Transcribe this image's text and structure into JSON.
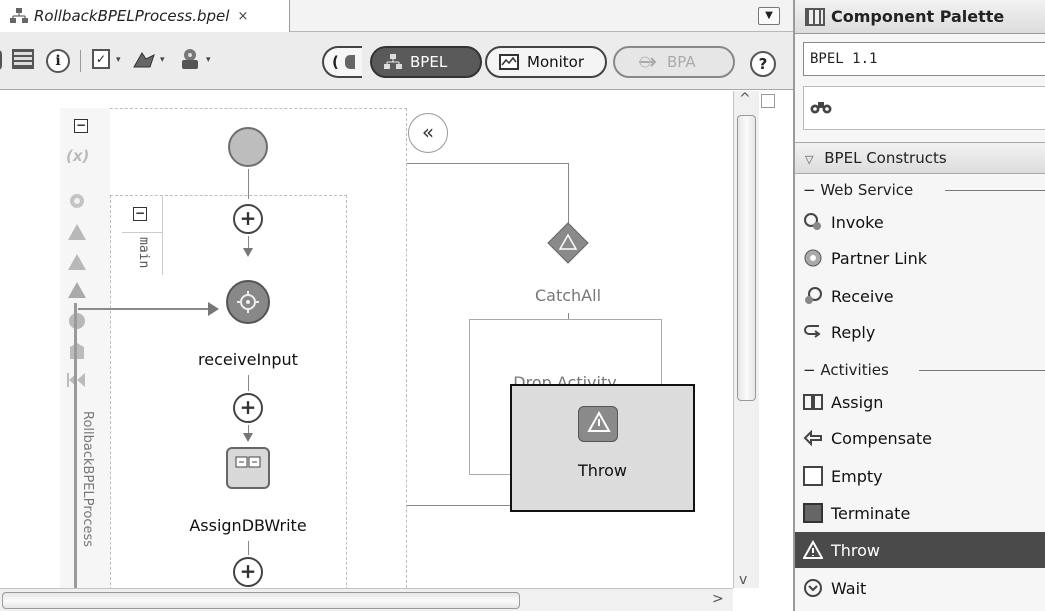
{
  "editor": {
    "tab": {
      "title": "RollbackBPELProcess.bpel",
      "close": "×"
    },
    "tab_menu": "▼",
    "toolbar": {
      "info": "i",
      "dropdown_arrow": "▾",
      "partial_button": "(",
      "bpel_label": "BPEL",
      "monitor_label": "Monitor",
      "bpa_label": "BPA",
      "help": "?"
    },
    "collapse_arrow": "«",
    "diagram": {
      "main_label": "main",
      "process_label": "RollbackBPELProcess",
      "nodes": {
        "receive": "receiveInput",
        "assign": "AssignDBWrite",
        "catchall": "CatchAll",
        "drop_hint": "Drop Activity Here",
        "throw": "Throw"
      },
      "gutter_variable": "(x)",
      "collapse": "⊟"
    },
    "scroll": {
      "up": "^",
      "down": "v",
      "right": ">"
    }
  },
  "palette": {
    "title": "Component Palette",
    "selected_library": "BPEL 1.1",
    "search_icon": "binoculars",
    "section": "BPEL Constructs",
    "section_toggle": "▽",
    "groups": [
      {
        "label": "Web Service",
        "items": [
          "Invoke",
          "Partner Link",
          "Receive",
          "Reply"
        ]
      },
      {
        "label": "Activities",
        "items": [
          "Assign",
          "Compensate",
          "Empty",
          "Terminate",
          "Throw",
          "Wait"
        ]
      }
    ],
    "group_toggle": "−",
    "selected_item": "Throw"
  }
}
